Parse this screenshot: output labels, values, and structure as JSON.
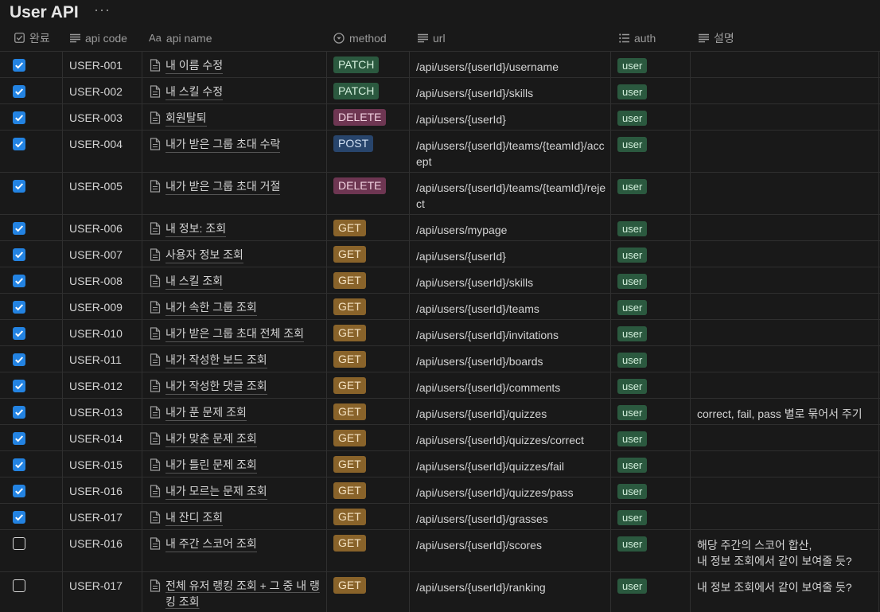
{
  "page": {
    "title": "User API",
    "more_icon": "ellipsis-icon"
  },
  "columns": {
    "done": "완료",
    "api_code": "api code",
    "api_name": "api name",
    "method": "method",
    "url": "url",
    "auth": "auth",
    "desc": "설명"
  },
  "method_colors": {
    "PATCH": {
      "bg": "#2b593f",
      "fg": "#d4f0dd"
    },
    "DELETE": {
      "bg": "#6e3652",
      "fg": "#f2d3e1"
    },
    "POST": {
      "bg": "#28456c",
      "fg": "#d3e2f5"
    },
    "GET": {
      "bg": "#89632a",
      "fg": "#f5e3c3"
    }
  },
  "rows": [
    {
      "done": true,
      "code": "USER-001",
      "name": "내 이름 수정",
      "method": "PATCH",
      "url": "/api/users/{userId}/username",
      "auth": "user",
      "desc": ""
    },
    {
      "done": true,
      "code": "USER-002",
      "name": "내 스킬 수정",
      "method": "PATCH",
      "url": "/api/users/{userId}/skills",
      "auth": "user",
      "desc": ""
    },
    {
      "done": true,
      "code": "USER-003",
      "name": "회원탈퇴",
      "method": "DELETE",
      "url": "/api/users/{userId}",
      "auth": "user",
      "desc": ""
    },
    {
      "done": true,
      "code": "USER-004",
      "name": "내가 받은 그룹 초대 수락",
      "method": "POST",
      "url": "/api/users/{userId}/teams/{teamId}/accept",
      "auth": "user",
      "desc": ""
    },
    {
      "done": true,
      "code": "USER-005",
      "name": "내가 받은 그룹 초대 거절",
      "method": "DELETE",
      "url": "/api/users/{userId}/teams/{teamId}/reject",
      "auth": "user",
      "desc": ""
    },
    {
      "done": true,
      "code": "USER-006",
      "name": "내 정보: 조회",
      "method": "GET",
      "url": "/api/users/mypage",
      "auth": "user",
      "desc": ""
    },
    {
      "done": true,
      "code": "USER-007",
      "name": "사용자 정보 조회",
      "method": "GET",
      "url": "/api/users/{userId}",
      "auth": "user",
      "desc": ""
    },
    {
      "done": true,
      "code": "USER-008",
      "name": "내 스킬 조회",
      "method": "GET",
      "url": "/api/users/{userId}/skills",
      "auth": "user",
      "desc": ""
    },
    {
      "done": true,
      "code": "USER-009",
      "name": "내가 속한 그룹 조회",
      "method": "GET",
      "url": "/api/users/{userId}/teams",
      "auth": "user",
      "desc": ""
    },
    {
      "done": true,
      "code": "USER-010",
      "name": "내가 받은 그룹 초대 전체 조회",
      "method": "GET",
      "url": "/api/users/{userId}/invitations",
      "auth": "user",
      "desc": ""
    },
    {
      "done": true,
      "code": "USER-011",
      "name": "내가 작성한 보드 조회",
      "method": "GET",
      "url": "/api/users/{userId}/boards",
      "auth": "user",
      "desc": ""
    },
    {
      "done": true,
      "code": "USER-012",
      "name": "내가 작성한 댓글 조회",
      "method": "GET",
      "url": "/api/users/{userId}/comments",
      "auth": "user",
      "desc": ""
    },
    {
      "done": true,
      "code": "USER-013",
      "name": "내가 푼 문제 조회",
      "method": "GET",
      "url": "/api/users/{userId}/quizzes",
      "auth": "user",
      "desc": "correct, fail, pass 별로 묶어서 주기"
    },
    {
      "done": true,
      "code": "USER-014",
      "name": "내가 맞춘 문제 조회",
      "method": "GET",
      "url": "/api/users/{userId}/quizzes/correct",
      "auth": "user",
      "desc": ""
    },
    {
      "done": true,
      "code": "USER-015",
      "name": "내가 틀린 문제 조회",
      "method": "GET",
      "url": "/api/users/{userId}/quizzes/fail",
      "auth": "user",
      "desc": ""
    },
    {
      "done": true,
      "code": "USER-016",
      "name": "내가 모르는 문제 조회",
      "method": "GET",
      "url": "/api/users/{userId}/quizzes/pass",
      "auth": "user",
      "desc": ""
    },
    {
      "done": true,
      "code": "USER-017",
      "name": "내 잔디 조회",
      "method": "GET",
      "url": "/api/users/{userId}/grasses",
      "auth": "user",
      "desc": ""
    },
    {
      "done": false,
      "code": "USER-016",
      "name": "내 주간 스코어 조회",
      "method": "GET",
      "url": "/api/users/{userId}/scores",
      "auth": "user",
      "desc": "해당 주간의 스코어 합산,\n내 정보 조회에서 같이 보여줄 듯?"
    },
    {
      "done": false,
      "code": "USER-017",
      "name": "전체 유저 랭킹 조회 + 그 중 내 랭킹 조회",
      "method": "GET",
      "url": "/api/users/{userId}/ranking",
      "auth": "user",
      "desc": "내 정보 조회에서 같이 보여줄 듯?"
    }
  ]
}
